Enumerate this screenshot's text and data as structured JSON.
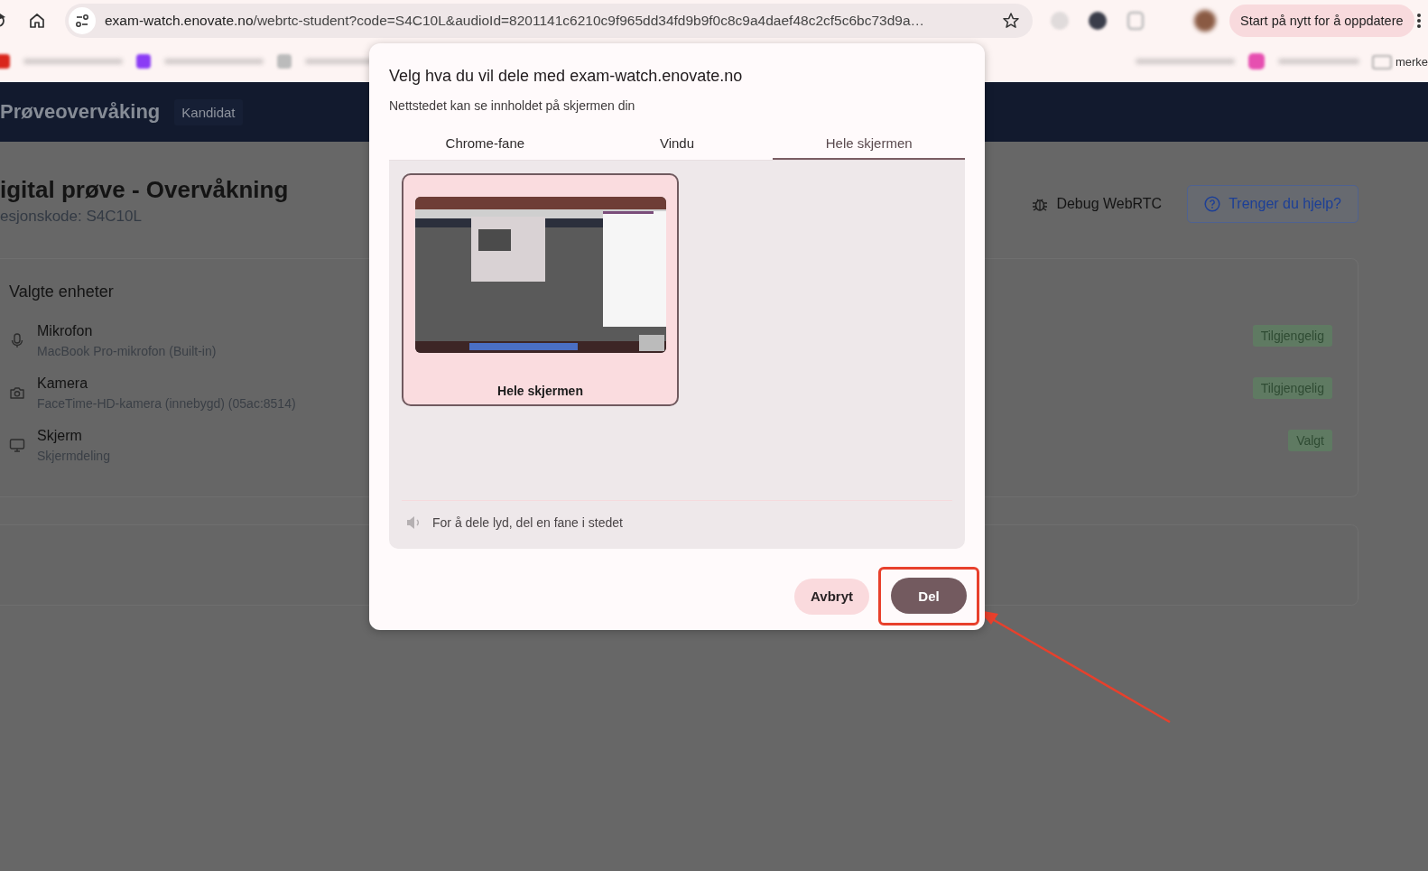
{
  "browser": {
    "address": {
      "host": "exam-watch.enovate.no",
      "path": "/webrtc-student?code=S4C10L&audioId=8201141c6210c9f965dd34fd9b9f0c8c9a4daef48c2cf5c6bc73d9a…"
    },
    "update_button": "Start på nytt for å oppdatere",
    "bookmarks": [
      {
        "label": "merke"
      }
    ]
  },
  "app": {
    "brand": "Prøveovervåking",
    "role_badge": "Kandidat",
    "page_title": "igital prøve - Overvåkning",
    "session_code": "esjonskode: S4C10L",
    "debug_link": "Debug WebRTC",
    "help_button": "Trenger du hjelp?",
    "devices_heading": "Valgte enheter",
    "devices": [
      {
        "kind": "microphone",
        "name": "Mikrofon",
        "detail": "MacBook Pro-mikrofon (Built-in)",
        "status": "Tilgjengelig"
      },
      {
        "kind": "camera",
        "name": "Kamera",
        "detail": "FaceTime-HD-kamera (innebygd) (05ac:8514)",
        "status": "Tilgjengelig"
      },
      {
        "kind": "screen",
        "name": "Skjerm",
        "detail": "Skjermdeling",
        "status": "Valgt"
      }
    ]
  },
  "dialog": {
    "title": "Velg hva du vil dele med exam-watch.enovate.no",
    "subtitle": "Nettstedet kan se innholdet på skjermen din",
    "tabs": [
      {
        "label": "Chrome-fane",
        "selected": false
      },
      {
        "label": "Vindu",
        "selected": false
      },
      {
        "label": "Hele skjermen",
        "selected": true
      }
    ],
    "sources": [
      {
        "label": "Hele skjermen",
        "selected": true
      }
    ],
    "audio_note": "For å dele lyd, del en fane i stedet",
    "buttons": [
      {
        "label": "Avbryt",
        "kind": "secondary",
        "highlighted": false
      },
      {
        "label": "Del",
        "kind": "primary",
        "highlighted": true
      }
    ]
  }
}
